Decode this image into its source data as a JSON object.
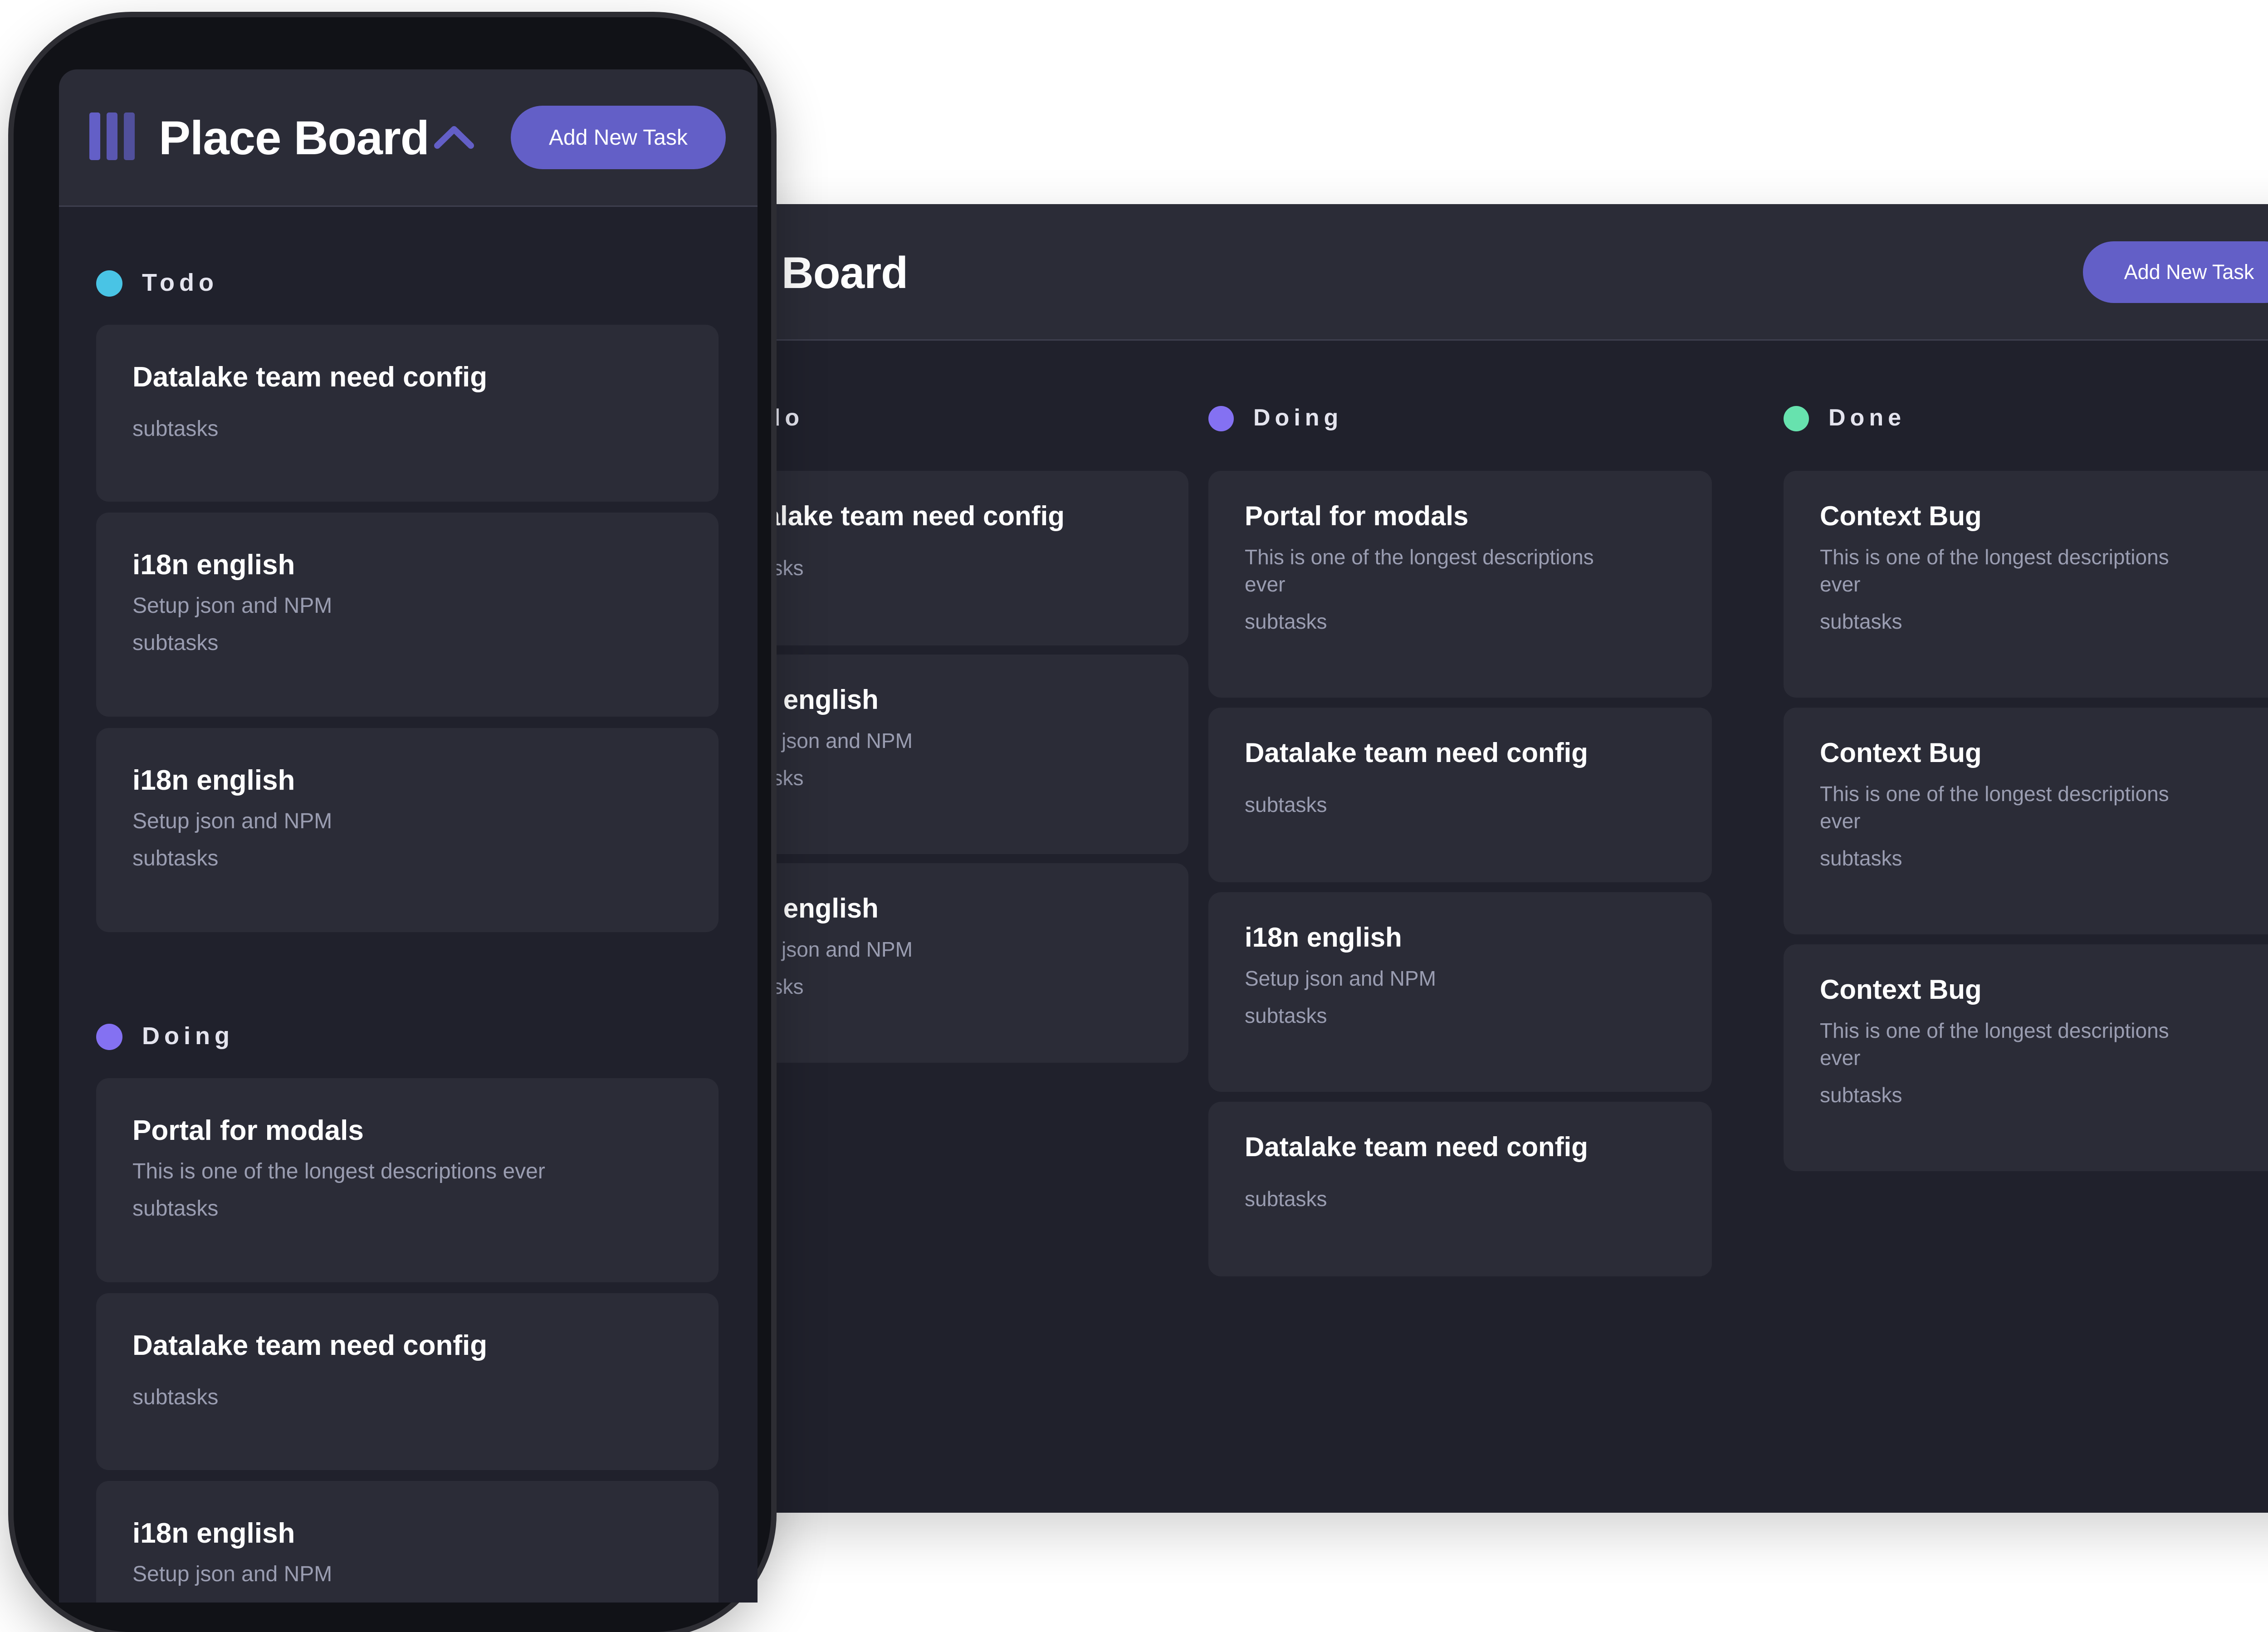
{
  "desktop": {
    "title": "Board",
    "add_button": "Add New Task",
    "columns": [
      {
        "name": "Todo",
        "color": "#49c4e5",
        "cards": [
          {
            "title": "Datalake team need config",
            "desc": "",
            "sub": "subtasks"
          },
          {
            "title": "i18n english",
            "desc": "Setup json and NPM",
            "sub": "subtasks"
          },
          {
            "title": "i18n english",
            "desc": "Setup json and NPM",
            "sub": "subtasks"
          }
        ]
      },
      {
        "name": "Doing",
        "color": "#8471f2",
        "cards": [
          {
            "title": "Portal for modals",
            "desc": "This is one of the longest descriptions ever",
            "sub": "subtasks"
          },
          {
            "title": "Datalake team need config",
            "desc": "",
            "sub": "subtasks"
          },
          {
            "title": "i18n english",
            "desc": "Setup json and NPM",
            "sub": "subtasks"
          },
          {
            "title": "Datalake team need config",
            "desc": "",
            "sub": "subtasks"
          }
        ]
      },
      {
        "name": "Done",
        "color": "#67e2ae",
        "cards": [
          {
            "title": "Context Bug",
            "desc": "This is one of the longest descriptions ever",
            "sub": "subtasks"
          },
          {
            "title": "Context Bug",
            "desc": "This is one of the longest descriptions ever",
            "sub": "subtasks"
          },
          {
            "title": "Context Bug",
            "desc": "This is one of the longest descriptions ever",
            "sub": "subtasks"
          }
        ]
      }
    ]
  },
  "mobile": {
    "title": "Place Board",
    "add_button": "Add New Task",
    "logo_icon": "board-logo-icon",
    "chevron_icon": "chevron-up-icon",
    "columns": [
      {
        "name": "Todo",
        "color": "#49c4e5",
        "cards": [
          {
            "title": "Datalake team need config",
            "desc": "",
            "sub": "subtasks"
          },
          {
            "title": "i18n english",
            "desc": "Setup json and NPM",
            "sub": "subtasks"
          },
          {
            "title": "i18n english",
            "desc": "Setup json and NPM",
            "sub": "subtasks"
          }
        ]
      },
      {
        "name": "Doing",
        "color": "#8471f2",
        "cards": [
          {
            "title": "Portal for modals",
            "desc": "This is one of the longest descriptions ever",
            "sub": "subtasks"
          },
          {
            "title": "Datalake team need config",
            "desc": "",
            "sub": "subtasks"
          },
          {
            "title": "i18n english",
            "desc": "Setup json and NPM",
            "sub": ""
          }
        ]
      }
    ]
  },
  "colors": {
    "accent": "#635fc7",
    "background": "#20212c",
    "card": "#2b2c37",
    "muted_text": "#9a9db1"
  }
}
